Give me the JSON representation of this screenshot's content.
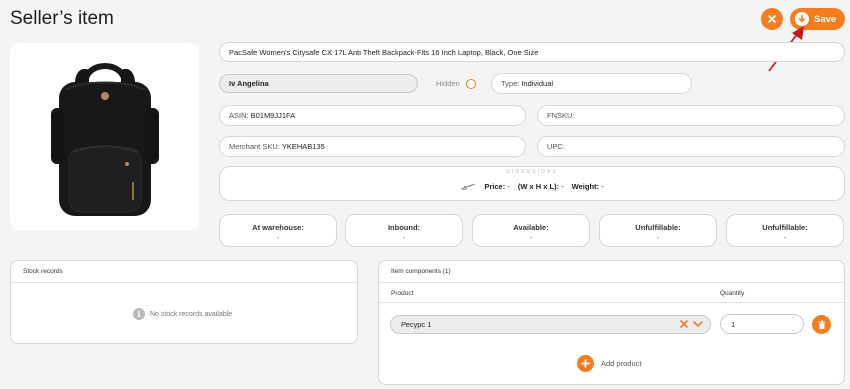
{
  "page": {
    "title": "Seller’s item"
  },
  "toolbar": {
    "save_label": "Save",
    "close_icon": "close-icon",
    "save_icon": "download-icon"
  },
  "product": {
    "title": "PacSafe Women's Citysafe CX 17L Anti Theft Backpack-Fits 16 Inch Laptop, Black, One Size",
    "image_icon": "backpack-image"
  },
  "owner": {
    "name": "Iv Angelina"
  },
  "hidden": {
    "label": "Hidden",
    "checked": false
  },
  "type": {
    "label": "Type:",
    "value": "Individual"
  },
  "ids": {
    "asin_label": "ASIN:",
    "asin_value": "B01M9JJ1FA",
    "fnsku_label": "FNSKU:",
    "fnsku_value": "",
    "sku_label": "Merchant SKU:",
    "sku_value": "YKEHAB135",
    "upc_label": "UPC:",
    "upc_value": ""
  },
  "dimensions": {
    "title": "DIMENSIONS",
    "icon": "scale-icon",
    "price_label": "Price:",
    "price_value": "-",
    "size_label": "(W x H x L):",
    "size_value": "-",
    "weight_label": "Weight:",
    "weight_value": "-"
  },
  "stats": [
    {
      "label": "At warehouse:",
      "value": "-"
    },
    {
      "label": "Inbound:",
      "value": "-"
    },
    {
      "label": "Available:",
      "value": "-"
    },
    {
      "label": "Unfulfillable:",
      "value": "-"
    },
    {
      "label": "Unfulfillable:",
      "value": "-"
    }
  ],
  "stock": {
    "title": "Stock records",
    "empty_text": "No stock records available",
    "empty_icon": "info-icon"
  },
  "components": {
    "title": "Item components (1)",
    "col_product": "Product",
    "col_quantity": "Quantity",
    "rows": [
      {
        "product": "Ресурс 1",
        "quantity": "1"
      }
    ],
    "add_label": "Add product"
  },
  "colors": {
    "accent": "#f57c1f",
    "arrow": "#c41818",
    "background": "#f4f4f4"
  }
}
